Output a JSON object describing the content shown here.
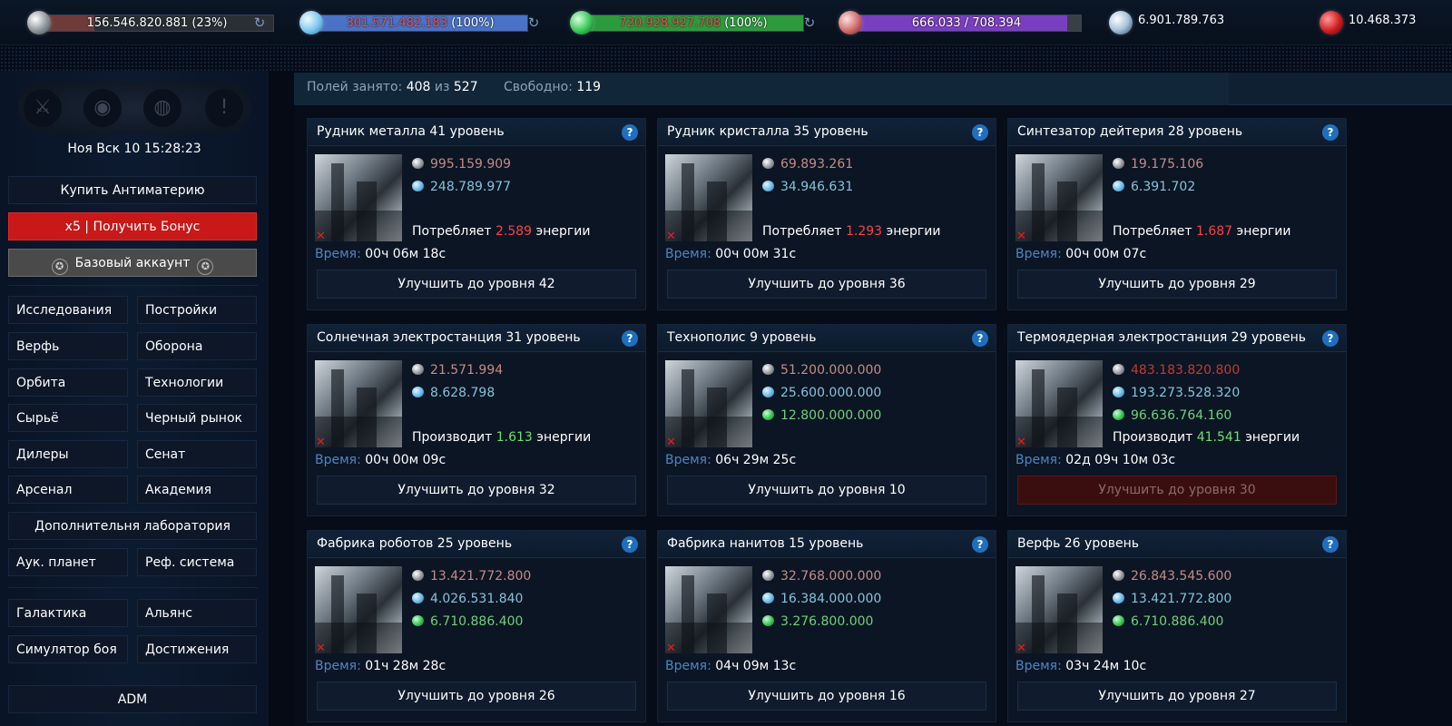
{
  "topbar": {
    "metal": {
      "text": "156.546.820.881 (23%)",
      "fill": 0.23,
      "color": "#6e3a3a"
    },
    "crystal": {
      "amount": "301.571.482.183",
      "pct": " (100%)",
      "fill": 1.0,
      "color": "#4a72c6"
    },
    "deuterium": {
      "amount": "720.928.927.708",
      "pct": " (100%)",
      "fill": 1.0,
      "color": "#2e9a3e"
    },
    "energy": {
      "current": "666.033",
      "sep": " / ",
      "max": "708.394",
      "fill": 0.94,
      "color": "#7a3fc0"
    },
    "dark_matter": "6.901.789.763",
    "antimatter": "10.468.373"
  },
  "sidebar": {
    "clock": "Ноя Вск 10 15:28:23",
    "buy_antimatter": "Купить Антиматерию",
    "bonus": "x5 | Получить Бонус",
    "account": "Базовый аккаунт",
    "menu": [
      [
        "Исследования",
        "Постройки"
      ],
      [
        "Верфь",
        "Оборона"
      ],
      [
        "Орбита",
        "Технологии"
      ],
      [
        "Сырьё",
        "Черный рынок"
      ],
      [
        "Дилеры",
        "Сенат"
      ],
      [
        "Арсенал",
        "Академия"
      ]
    ],
    "extra_lab": "Дополнительня лаборатория",
    "menu2": [
      "Аук. планет",
      "Реф. система"
    ],
    "menu3": [
      [
        "Галактика",
        "Альянс"
      ],
      [
        "Симулятор боя",
        "Достижения"
      ]
    ],
    "adm": "ADM"
  },
  "fields": {
    "used_label": "Полей занято:",
    "used": "408",
    "of": "из",
    "total": "527",
    "free_label": "Свободно:",
    "free": "119"
  },
  "labels": {
    "time": "Время:",
    "consumes": "Потребляет",
    "produces": "Производит",
    "energy_word": "энергии",
    "help": "?"
  },
  "buildings": [
    {
      "title": "Рудник металла 41 уровень",
      "metal": "995.159.909",
      "crystal": "248.789.977",
      "energy_mode": "consumes",
      "energy": "2.589",
      "time": "00ч 06м 18с",
      "upgrade": "Улучшить до уровня 42"
    },
    {
      "title": "Рудник кристалла 35 уровень",
      "metal": "69.893.261",
      "crystal": "34.946.631",
      "energy_mode": "consumes",
      "energy": "1.293",
      "time": "00ч 00м 31с",
      "upgrade": "Улучшить до уровня 36"
    },
    {
      "title": "Синтезатор дейтерия 28 уровень",
      "metal": "19.175.106",
      "crystal": "6.391.702",
      "energy_mode": "consumes",
      "energy": "1.687",
      "time": "00ч 00м 07с",
      "upgrade": "Улучшить до уровня 29"
    },
    {
      "title": "Солнечная электростанция 31 уровень",
      "metal": "21.571.994",
      "crystal": "8.628.798",
      "energy_mode": "produces",
      "energy": "1.613",
      "time": "00ч 00м 09с",
      "upgrade": "Улучшить до уровня 32"
    },
    {
      "title": "Технополис 9 уровень",
      "metal": "51.200.000.000",
      "crystal": "25.600.000.000",
      "deut": "12.800.000.000",
      "time": "06ч 29м 25с",
      "upgrade": "Улучшить до уровня 10"
    },
    {
      "title": "Термоядерная электростанция 29 уровень",
      "metal": "483.183.820.800",
      "metal_short": true,
      "crystal": "193.273.528.320",
      "deut": "96.636.764.160",
      "energy_mode": "produces",
      "energy": "41.541",
      "time": "02д 09ч 10м 03с",
      "upgrade": "Улучшить до уровня 30",
      "disabled": true
    },
    {
      "title": "Фабрика роботов 25 уровень",
      "metal": "13.421.772.800",
      "crystal": "4.026.531.840",
      "deut": "6.710.886.400",
      "time": "01ч 28м 28с",
      "upgrade": "Улучшить до уровня 26"
    },
    {
      "title": "Фабрика нанитов 15 уровень",
      "metal": "32.768.000.000",
      "crystal": "16.384.000.000",
      "deut": "3.276.800.000",
      "time": "04ч 09м 13с",
      "upgrade": "Улучшить до уровня 16"
    },
    {
      "title": "Верфь 26 уровень",
      "metal": "26.843.545.600",
      "crystal": "13.421.772.800",
      "deut": "6.710.886.400",
      "time": "03ч 24м 10с",
      "upgrade": "Улучшить до уровня 27"
    }
  ]
}
